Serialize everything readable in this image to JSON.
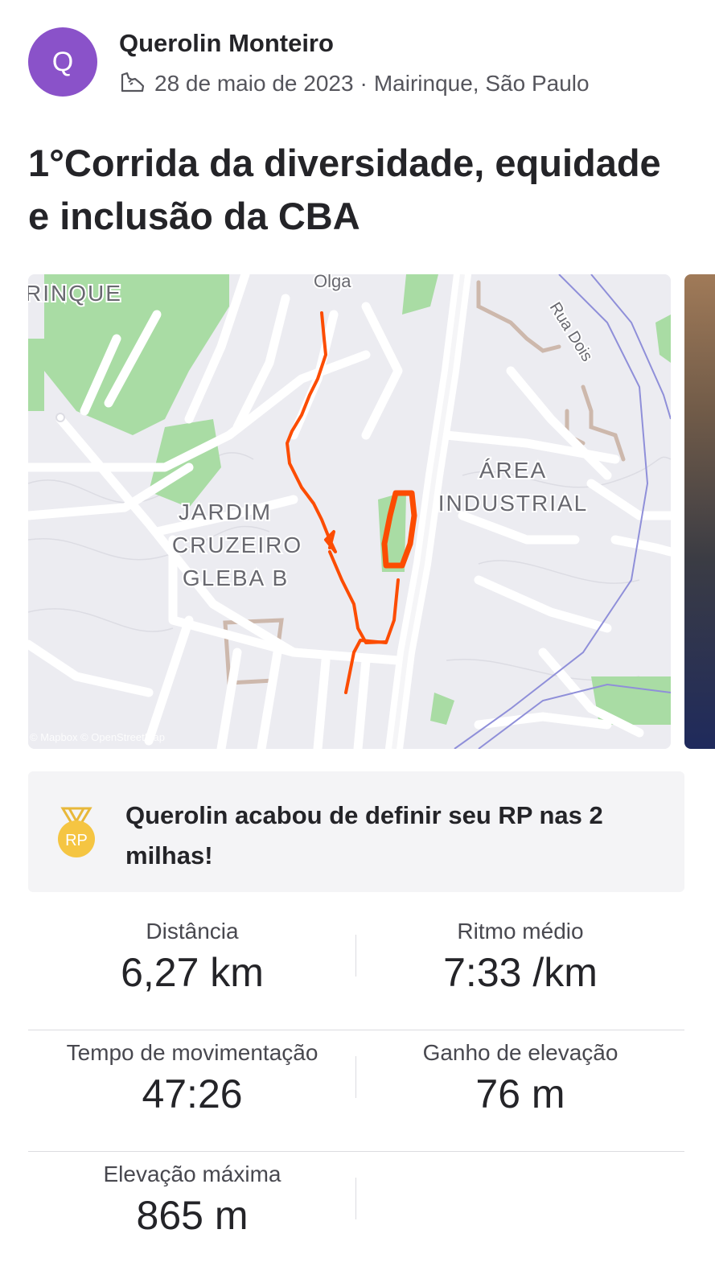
{
  "activity": {
    "athlete": {
      "initial": "Q",
      "name": "Querolin Monteiro",
      "avatar_color": "#8a52c9"
    },
    "activity_type_icon": "running-shoe-icon",
    "date": "28 de maio de 2023",
    "separator": "·",
    "location": "Mairinque, São Paulo",
    "title": "1°Corrida da diversidade, equidade e inclusão da CBA"
  },
  "map": {
    "labels": {
      "town": "RINQUE",
      "street_olga": "Olga",
      "street_rua_dois": "Rua Dois",
      "area_industrial_1": "ÁREA",
      "area_industrial_2": "INDUSTRIAL",
      "jardim_1": "JARDIM",
      "jardim_2": "CRUZEIRO",
      "jardim_3": "GLEBA B"
    },
    "attribution": "© Mapbox © OpenStreetMap",
    "route_color": "#fc4c02"
  },
  "achievement": {
    "badge_text": "RP",
    "badge_color": "#f5c542",
    "message": "Querolin acabou de definir seu RP nas 2 milhas!"
  },
  "stats": [
    {
      "label": "Distância",
      "value": "6,27 km"
    },
    {
      "label": "Ritmo médio",
      "value": "7:33 /km"
    },
    {
      "label": "Tempo de movimentação",
      "value": "47:26"
    },
    {
      "label": "Ganho de elevação",
      "value": "76 m"
    },
    {
      "label": "Elevação máxima",
      "value": "865 m"
    }
  ]
}
